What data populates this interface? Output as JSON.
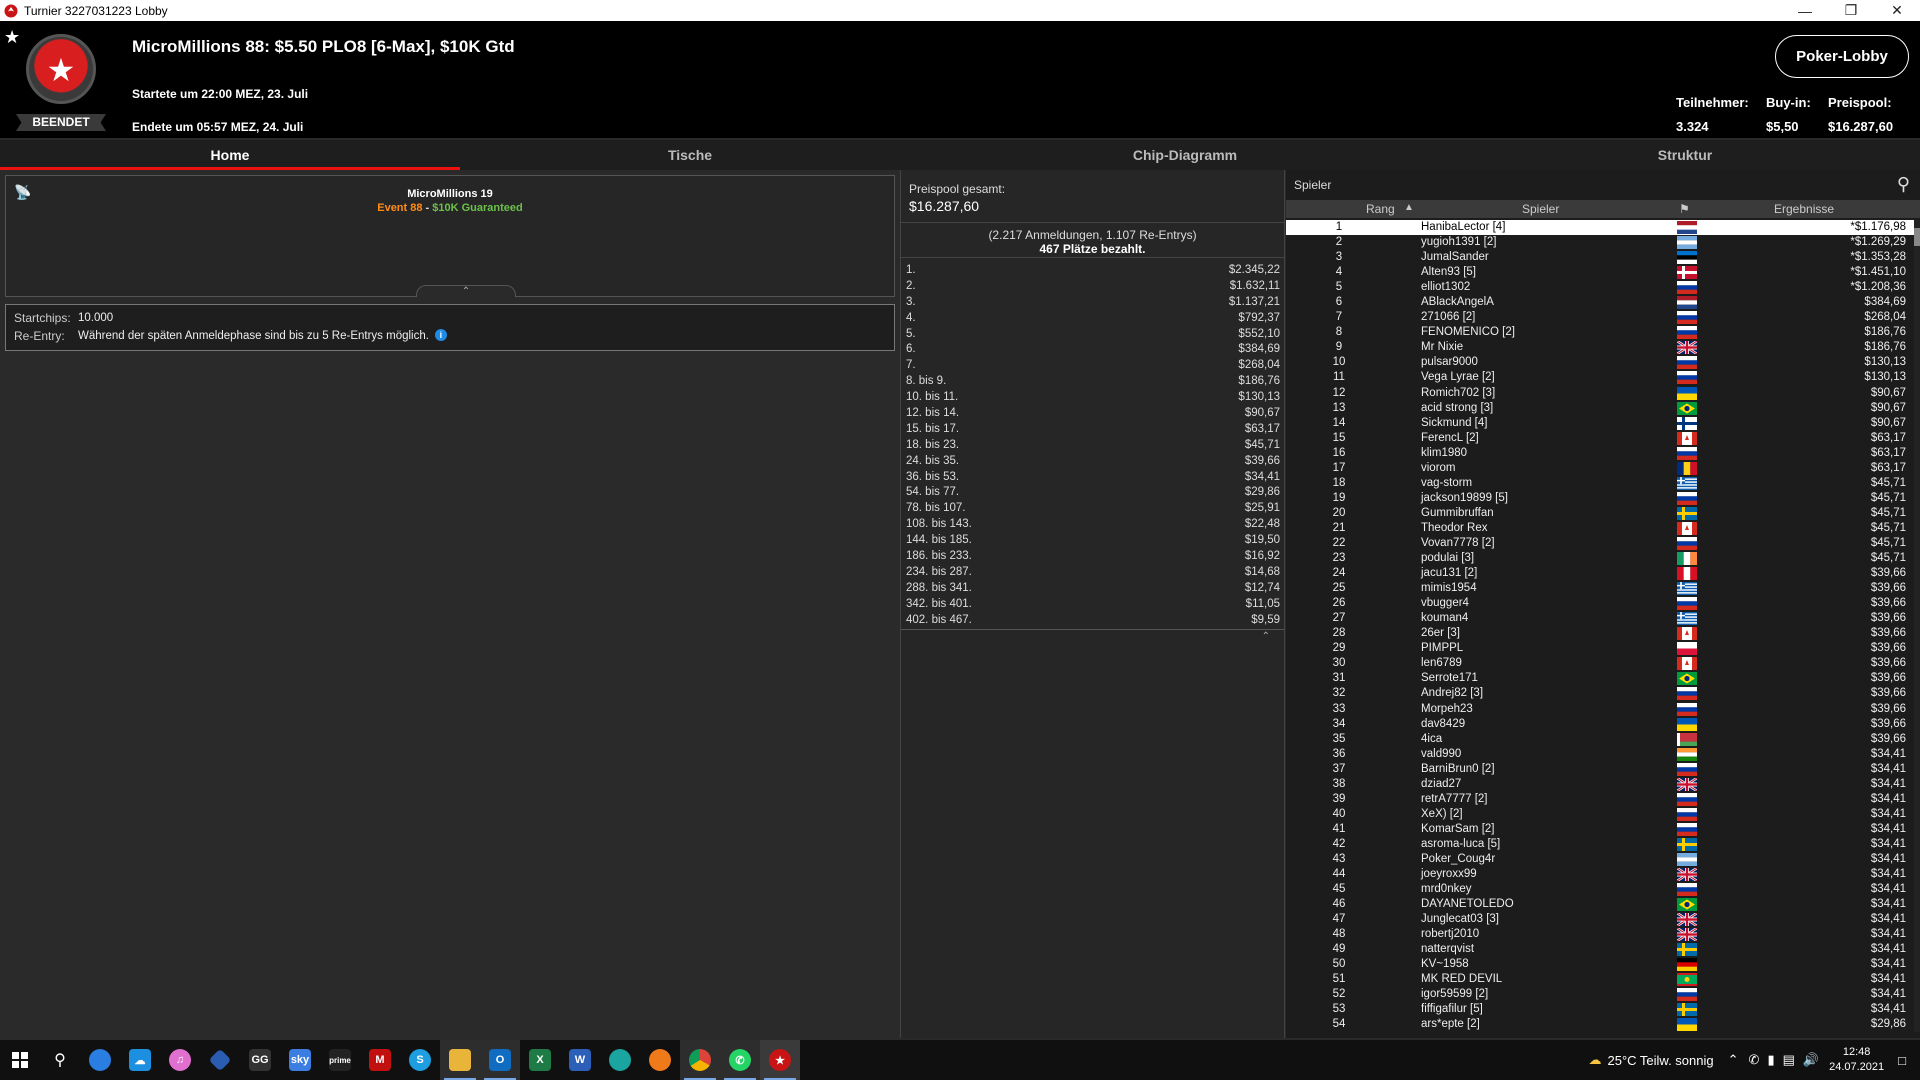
{
  "window": {
    "title": "Turnier 3227031223 Lobby"
  },
  "header": {
    "tournament_name": "MicroMillions 88: $5.50 PLO8 [6-Max], $10K Gtd",
    "started": "Startete um 22:00 MEZ, 23. Juli",
    "ended": "Endete um 05:57 MEZ, 24. Juli",
    "status_badge": "BEENDET",
    "lobby_button": "Poker-Lobby",
    "stats": {
      "participants_label": "Teilnehmer:",
      "participants_value": "3.324",
      "buyin_label": "Buy-in:",
      "buyin_value": "$5,50",
      "prizepool_label": "Preispool:",
      "prizepool_value": "$16.287,60"
    }
  },
  "tabs": [
    "Home",
    "Tische",
    "Chip-Diagramm",
    "Struktur"
  ],
  "home": {
    "series_title": "MicroMillions 19",
    "event": "Event 88",
    "separator": " - ",
    "guarantee": "$10K Guaranteed",
    "startchips_label": "Startchips:",
    "startchips_value": "10.000",
    "reentry_label": "Re-Entry:",
    "reentry_value": "Während der späten Anmeldephase sind bis zu 5 Re-Entrys möglich."
  },
  "prizepool": {
    "label": "Preispool gesamt:",
    "value": "$16.287,60",
    "entries": "(2.217 Anmeldungen, 1.107 Re-Entrys)",
    "paid": "467 Plätze bezahlt.",
    "payouts": [
      [
        "1.",
        "$2.345,22"
      ],
      [
        "2.",
        "$1.632,11"
      ],
      [
        "3.",
        "$1.137,21"
      ],
      [
        "4.",
        "$792,37"
      ],
      [
        "5.",
        "$552,10"
      ],
      [
        "6.",
        "$384,69"
      ],
      [
        "7.",
        "$268,04"
      ],
      [
        "8. bis 9.",
        "$186,76"
      ],
      [
        "10. bis 11.",
        "$130,13"
      ],
      [
        "12. bis 14.",
        "$90,67"
      ],
      [
        "15. bis 17.",
        "$63,17"
      ],
      [
        "18. bis 23.",
        "$45,71"
      ],
      [
        "24. bis 35.",
        "$39,66"
      ],
      [
        "36. bis 53.",
        "$34,41"
      ],
      [
        "54. bis 77.",
        "$29,86"
      ],
      [
        "78. bis 107.",
        "$25,91"
      ],
      [
        "108. bis 143.",
        "$22,48"
      ],
      [
        "144. bis 185.",
        "$19,50"
      ],
      [
        "186. bis 233.",
        "$16,92"
      ],
      [
        "234. bis 287.",
        "$14,68"
      ],
      [
        "288. bis 341.",
        "$12,74"
      ],
      [
        "342. bis 401.",
        "$11,05"
      ],
      [
        "402. bis 467.",
        "$9,59"
      ]
    ]
  },
  "players": {
    "title": "Spieler",
    "col_rank": "Rang",
    "col_player": "Spieler",
    "col_result": "Ergebnisse",
    "rows": [
      [
        "1",
        "HanibaLector [4]",
        "*$1.176,98",
        "nl"
      ],
      [
        "2",
        "yugioh1391 [2]",
        "*$1.269,29",
        "ar"
      ],
      [
        "3",
        "JumalSander",
        "*$1.353,28",
        "ee"
      ],
      [
        "4",
        "Alten93 [5]",
        "*$1.451,10",
        "dk"
      ],
      [
        "5",
        "elliot1302",
        "*$1.208,36",
        "ru"
      ],
      [
        "6",
        "ABlackAngelA",
        "$384,69",
        "nl"
      ],
      [
        "7",
        "271066 [2]",
        "$268,04",
        "ru"
      ],
      [
        "8",
        "FENOMENICO [2]",
        "$186,76",
        "ru"
      ],
      [
        "9",
        "Mr Nixie",
        "$186,76",
        "gb"
      ],
      [
        "10",
        "pulsar9000",
        "$130,13",
        "ru"
      ],
      [
        "11",
        "Vega Lyrae [2]",
        "$130,13",
        "ru"
      ],
      [
        "12",
        "Romich702 [3]",
        "$90,67",
        "ua"
      ],
      [
        "13",
        "acid strong [3]",
        "$90,67",
        "br"
      ],
      [
        "14",
        "Sickmund [4]",
        "$90,67",
        "fi"
      ],
      [
        "15",
        "FerencL [2]",
        "$63,17",
        "ca"
      ],
      [
        "16",
        "klim1980",
        "$63,17",
        "ru"
      ],
      [
        "17",
        "viorom",
        "$63,17",
        "ro"
      ],
      [
        "18",
        "vag-storm",
        "$45,71",
        "gr"
      ],
      [
        "19",
        "jackson19899 [5]",
        "$45,71",
        "ru"
      ],
      [
        "20",
        "Gummibruffan",
        "$45,71",
        "se"
      ],
      [
        "21",
        "Theodor Rex",
        "$45,71",
        "ca"
      ],
      [
        "22",
        "Vovan7778 [2]",
        "$45,71",
        "ru"
      ],
      [
        "23",
        "podulai [3]",
        "$45,71",
        "ie"
      ],
      [
        "24",
        "jacu131 [2]",
        "$39,66",
        "pe"
      ],
      [
        "25",
        "mimis1954",
        "$39,66",
        "gr"
      ],
      [
        "26",
        "vbugger4",
        "$39,66",
        "ru"
      ],
      [
        "27",
        "kouman4",
        "$39,66",
        "gr"
      ],
      [
        "28",
        "26er [3]",
        "$39,66",
        "ca"
      ],
      [
        "29",
        "PIMPPL",
        "$39,66",
        "pl"
      ],
      [
        "30",
        "len6789",
        "$39,66",
        "ca"
      ],
      [
        "31",
        "Serrote171",
        "$39,66",
        "br"
      ],
      [
        "32",
        "Andrej82 [3]",
        "$39,66",
        "ru"
      ],
      [
        "33",
        "Morpeh23",
        "$39,66",
        "ru"
      ],
      [
        "34",
        "dav8429",
        "$39,66",
        "ua"
      ],
      [
        "35",
        "4ica",
        "$39,66",
        "by"
      ],
      [
        "36",
        "vald990",
        "$34,41",
        "in"
      ],
      [
        "37",
        "BarniBrun0 [2]",
        "$34,41",
        "ru"
      ],
      [
        "38",
        "dziad27",
        "$34,41",
        "gb"
      ],
      [
        "39",
        "retrA7777 [2]",
        "$34,41",
        "ru"
      ],
      [
        "40",
        "XeX) [2]",
        "$34,41",
        "ru"
      ],
      [
        "41",
        "KomarSam [2]",
        "$34,41",
        "ru"
      ],
      [
        "42",
        "asroma-luca [5]",
        "$34,41",
        "se"
      ],
      [
        "43",
        "Poker_Coug4r",
        "$34,41",
        "ar"
      ],
      [
        "44",
        "joeyroxx99",
        "$34,41",
        "gb"
      ],
      [
        "45",
        "mrd0nkey",
        "$34,41",
        "ru"
      ],
      [
        "46",
        "DAYANETOLEDO",
        "$34,41",
        "br"
      ],
      [
        "47",
        "Junglecat03 [3]",
        "$34,41",
        "gb"
      ],
      [
        "48",
        "robertj2010",
        "$34,41",
        "gb"
      ],
      [
        "49",
        "natterqvist",
        "$34,41",
        "se"
      ],
      [
        "50",
        "KV~1958",
        "$34,41",
        "de"
      ],
      [
        "51",
        "MK RED DEVIL",
        "$34,41",
        "mr"
      ],
      [
        "52",
        "igor59599 [2]",
        "$34,41",
        "ru"
      ],
      [
        "53",
        "fiffigafilur [5]",
        "$34,41",
        "se"
      ],
      [
        "54",
        "ars*epte [2]",
        "$29,86",
        "ua"
      ]
    ]
  },
  "taskbar": {
    "weather": "25°C  Teilw. sonnig",
    "time": "12:48",
    "date": "24.07.2021",
    "apps": [
      "windows-start",
      "search",
      "cortana",
      "onedrive",
      "itunes",
      "app-diamond",
      "gg",
      "sky",
      "prime-video",
      "mcafee",
      "skype",
      "explorer",
      "outlook",
      "excel",
      "word",
      "edge",
      "firefox",
      "chrome",
      "whatsapp",
      "pokerstars"
    ]
  },
  "colors": {
    "accent_red": "#e11111",
    "event_orange": "#ff8c1a",
    "guarantee_green": "#6cc04a"
  }
}
